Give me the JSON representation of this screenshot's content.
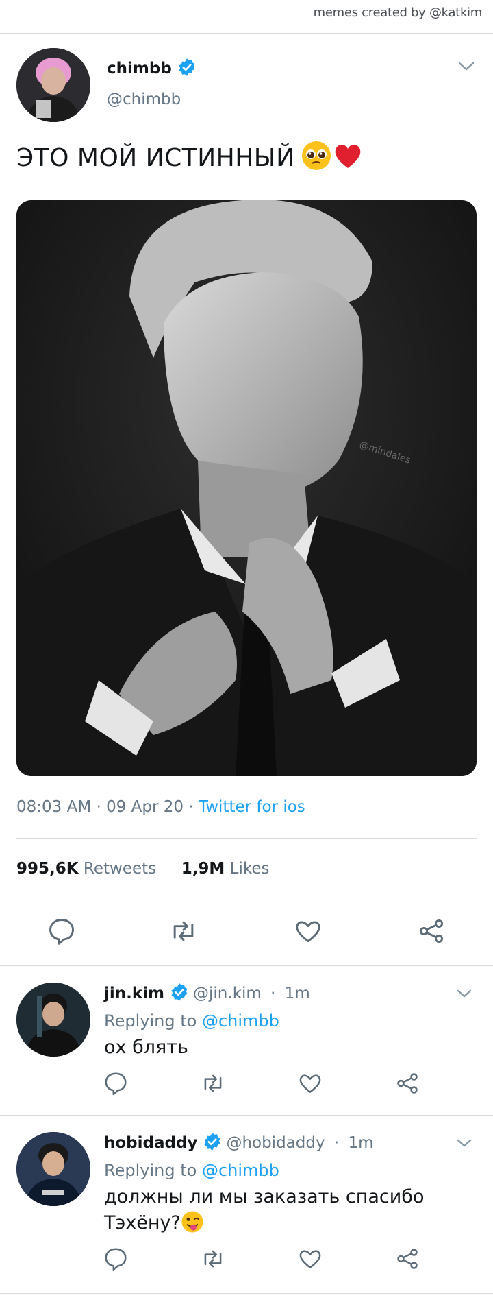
{
  "credit": "memes created by @katkim",
  "tweet": {
    "name": "chimbb",
    "handle": "@chimbb",
    "text": "ЭТО МОЙ ИСТИННЫЙ",
    "time": "08:03 AM",
    "date": "09 Apr 20",
    "source": "Twitter for ios",
    "retweets_count": "995,6K",
    "retweets_label": "Retweets",
    "likes_count": "1,9M",
    "likes_label": "Likes",
    "watermark": "@mindales"
  },
  "replies": [
    {
      "name": "jin.kim",
      "handle": "@jin.kim",
      "age": "1m",
      "replying_label": "Replying to",
      "replying_to": "@chimbb",
      "text": "ох блять"
    },
    {
      "name": "hobidaddy",
      "handle": "@hobidaddy",
      "age": "1m",
      "replying_label": "Replying to",
      "replying_to": "@chimbb",
      "text": "должны ли мы заказать спасибо Тэхёну?"
    }
  ],
  "colors": {
    "accent": "#1da1f2",
    "secondary": "#657786",
    "divider": "#d6dadd"
  },
  "icons": [
    "verified-badge-icon",
    "chevron-down-icon",
    "reply-icon",
    "retweet-icon",
    "like-icon",
    "share-icon",
    "pleading-face-emoji",
    "red-heart-emoji",
    "winking-tongue-emoji"
  ]
}
